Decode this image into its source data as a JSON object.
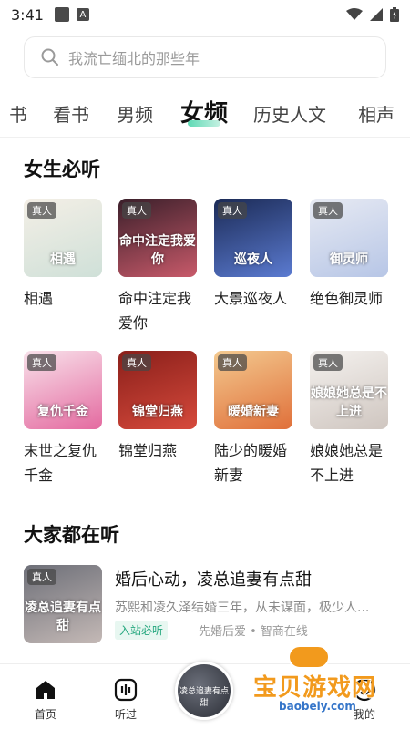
{
  "status": {
    "time": "3:41",
    "app_icon": "A"
  },
  "search": {
    "placeholder": "我流亡缅北的那些年"
  },
  "tabs": [
    {
      "label": "书"
    },
    {
      "label": "看书"
    },
    {
      "label": "男频"
    },
    {
      "label": "女频",
      "active": true
    },
    {
      "label": "历史人文"
    },
    {
      "label": "相声"
    }
  ],
  "section1": {
    "title": "女生必听",
    "books": [
      {
        "title": "相遇",
        "badge": "真人",
        "cover_text": "相遇",
        "colors": [
          "#f4efe6",
          "#cfe0d8"
        ]
      },
      {
        "title": "命中注定我爱你",
        "badge": "真人",
        "cover_text": "命中注定我爱你",
        "colors": [
          "#3a1f2a",
          "#c85a6a"
        ]
      },
      {
        "title": "大景巡夜人",
        "badge": "真人",
        "cover_text": "巡夜人",
        "colors": [
          "#1b2a55",
          "#5b7bd1"
        ]
      },
      {
        "title": "绝色御灵师",
        "badge": "真人",
        "cover_text": "御灵师",
        "colors": [
          "#e7eaf3",
          "#b7c6e6"
        ]
      },
      {
        "title": "末世之复仇千金",
        "badge": "真人",
        "cover_text": "复仇千金",
        "colors": [
          "#f8e1ea",
          "#e46aa0"
        ]
      },
      {
        "title": "锦堂归燕",
        "badge": "真人",
        "cover_text": "锦堂归燕",
        "colors": [
          "#8a1f1a",
          "#d64a3c"
        ]
      },
      {
        "title": "陆少的暖婚新妻",
        "badge": "真人",
        "cover_text": "暖婚新妻",
        "colors": [
          "#f3c98f",
          "#e0703a"
        ]
      },
      {
        "title": "娘娘她总是不上进",
        "badge": "真人",
        "cover_text": "娘娘她总是不上进",
        "colors": [
          "#f4f1ee",
          "#cfc6c0"
        ]
      }
    ]
  },
  "section2": {
    "title": "大家都在听",
    "items": [
      {
        "badge": "真人",
        "cover_text": "凌总追妻有点甜",
        "title": "婚后心动，凌总追妻有点甜",
        "desc": "苏熙和凌久泽结婚三年，从未谋面，极少人...",
        "tag": "入站必听",
        "meta": "先婚后爱 • 智商在线",
        "colors": [
          "#6d6f78",
          "#c4b9b6"
        ]
      }
    ]
  },
  "bottom_nav": {
    "home": "首页",
    "listened": "听过",
    "disc_text": "凌总追妻有点甜",
    "mine": "我的"
  },
  "watermark": {
    "main": "宝贝游戏网",
    "sub": "baobeiy.com"
  }
}
